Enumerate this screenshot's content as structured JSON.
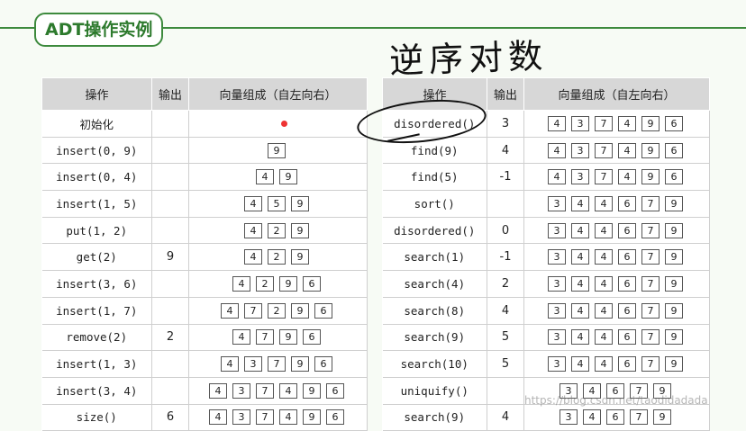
{
  "slide_title": "ADT操作实例",
  "handwritten_note": "逆序对数",
  "watermark": "https://blog.csdn.net/taodidadada",
  "headers": {
    "op": "操作",
    "out": "输出",
    "vec": "向量组成（自左向右）"
  },
  "left_rows": [
    {
      "op": "初始化",
      "out": "",
      "vec": []
    },
    {
      "op": "insert(0, 9)",
      "out": "",
      "vec": [
        "9"
      ]
    },
    {
      "op": "insert(0, 4)",
      "out": "",
      "vec": [
        "4",
        "9"
      ]
    },
    {
      "op": "insert(1, 5)",
      "out": "",
      "vec": [
        "4",
        "5",
        "9"
      ]
    },
    {
      "op": "put(1, 2)",
      "out": "",
      "vec": [
        "4",
        "2",
        "9"
      ]
    },
    {
      "op": "get(2)",
      "out": "9",
      "vec": [
        "4",
        "2",
        "9"
      ]
    },
    {
      "op": "insert(3, 6)",
      "out": "",
      "vec": [
        "4",
        "2",
        "9",
        "6"
      ]
    },
    {
      "op": "insert(1, 7)",
      "out": "",
      "vec": [
        "4",
        "7",
        "2",
        "9",
        "6"
      ]
    },
    {
      "op": "remove(2)",
      "out": "2",
      "vec": [
        "4",
        "7",
        "9",
        "6"
      ]
    },
    {
      "op": "insert(1, 3)",
      "out": "",
      "vec": [
        "4",
        "3",
        "7",
        "9",
        "6"
      ]
    },
    {
      "op": "insert(3, 4)",
      "out": "",
      "vec": [
        "4",
        "3",
        "7",
        "4",
        "9",
        "6"
      ]
    },
    {
      "op": "size()",
      "out": "6",
      "vec": [
        "4",
        "3",
        "7",
        "4",
        "9",
        "6"
      ]
    }
  ],
  "right_rows": [
    {
      "op": "disordered()",
      "out": "3",
      "vec": [
        "4",
        "3",
        "7",
        "4",
        "9",
        "6"
      ]
    },
    {
      "op": "find(9)",
      "out": "4",
      "vec": [
        "4",
        "3",
        "7",
        "4",
        "9",
        "6"
      ]
    },
    {
      "op": "find(5)",
      "out": "-1",
      "vec": [
        "4",
        "3",
        "7",
        "4",
        "9",
        "6"
      ]
    },
    {
      "op": "sort()",
      "out": "",
      "vec": [
        "3",
        "4",
        "4",
        "6",
        "7",
        "9"
      ]
    },
    {
      "op": "disordered()",
      "out": "0",
      "vec": [
        "3",
        "4",
        "4",
        "6",
        "7",
        "9"
      ]
    },
    {
      "op": "search(1)",
      "out": "-1",
      "vec": [
        "3",
        "4",
        "4",
        "6",
        "7",
        "9"
      ]
    },
    {
      "op": "search(4)",
      "out": "2",
      "vec": [
        "3",
        "4",
        "4",
        "6",
        "7",
        "9"
      ]
    },
    {
      "op": "search(8)",
      "out": "4",
      "vec": [
        "3",
        "4",
        "4",
        "6",
        "7",
        "9"
      ]
    },
    {
      "op": "search(9)",
      "out": "5",
      "vec": [
        "3",
        "4",
        "4",
        "6",
        "7",
        "9"
      ]
    },
    {
      "op": "search(10)",
      "out": "5",
      "vec": [
        "3",
        "4",
        "4",
        "6",
        "7",
        "9"
      ]
    },
    {
      "op": "uniquify()",
      "out": "",
      "vec": [
        "3",
        "4",
        "6",
        "7",
        "9"
      ]
    },
    {
      "op": "search(9)",
      "out": "4",
      "vec": [
        "3",
        "4",
        "6",
        "7",
        "9"
      ]
    }
  ],
  "colors": {
    "accent": "#3d8a3d",
    "header_bg": "#d7d7d7",
    "dot": "#e33333"
  }
}
